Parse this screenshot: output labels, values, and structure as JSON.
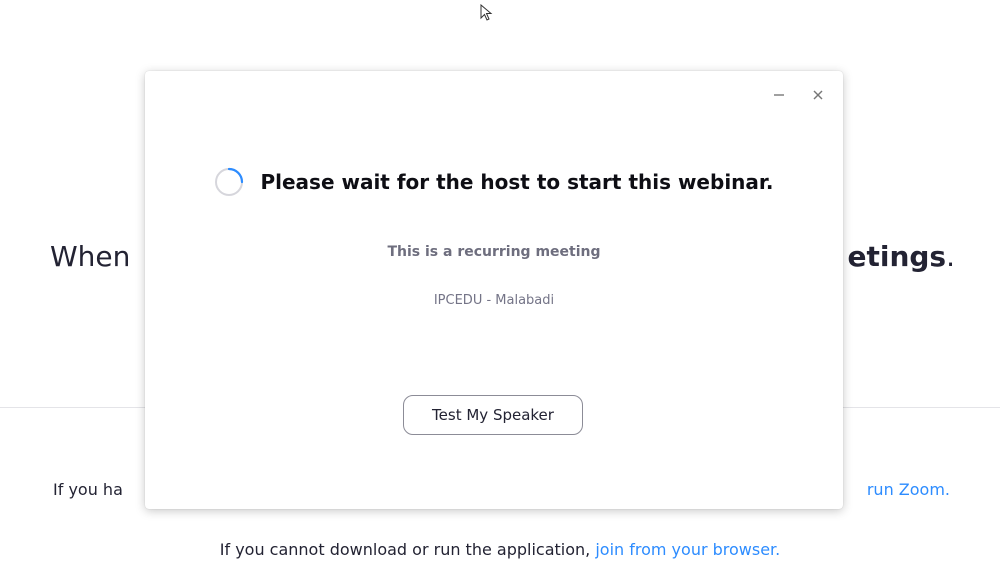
{
  "background": {
    "heading_lead": "When",
    "heading_tail": "etings",
    "heading_dot": ".",
    "line1_lead": "If you ha",
    "line1_link": "run Zoom.",
    "line2_text": "If you cannot download or run the application, ",
    "line2_link": "join from your browser."
  },
  "dialog": {
    "status": "Please wait for the host to start this webinar.",
    "recurring_note": "This is a recurring meeting",
    "meeting_name": "IPCEDU - Malabadi",
    "test_speaker_label": "Test My Speaker",
    "icons": {
      "minimize": "minimize-icon",
      "close": "close-icon",
      "spinner": "loading-spinner-icon"
    }
  },
  "colors": {
    "link": "#2d8cff",
    "spinner": "#2d8cff",
    "text_dark": "#232333",
    "text_muted": "#747487"
  }
}
